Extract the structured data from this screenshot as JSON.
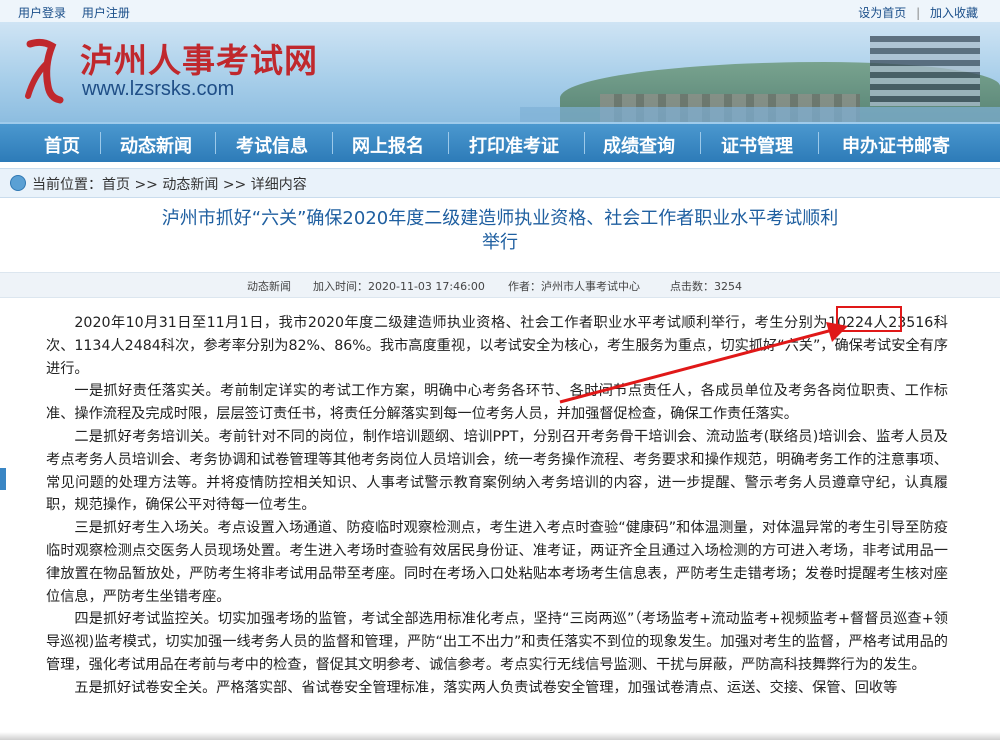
{
  "topbar": {
    "login": "用户登录",
    "register": "用户注册",
    "set_home": "设为首页",
    "separator": "|",
    "add_fav": "加入收藏"
  },
  "header": {
    "site_name": "泸州人事考试网",
    "site_url": "www.lzsrsks.com",
    "brand_color": "#c0282d"
  },
  "nav": {
    "items": [
      "首页",
      "动态新闻",
      "考试信息",
      "网上报名",
      "打印准考证",
      "成绩查询",
      "证书管理",
      "申办证书邮寄"
    ]
  },
  "breadcrumb": {
    "prefix": "当前位置：",
    "home": "首页",
    "sep": " >> ",
    "section": "动态新闻",
    "current": "详细内容"
  },
  "article": {
    "title_line1": "泸州市抓好“六关”确保2020年度二级建造师执业资格、社会工作者职业水平考试顺利",
    "title_line2": "举行",
    "meta": {
      "category": "动态新闻",
      "added": "加入时间：2020-11-03 17:46:00",
      "author": "作者：泸州市人事考试中心",
      "clicks": "点击数：3254"
    },
    "p1_before": "2020年10月31日至11月1日，我市2020年度二级建造师执业资格、社会工作者职业水平考试顺利举行，考生分别为",
    "p1_highlight": "10224人",
    "p1_after": "23516科次、1134人2484科次，参考率分别为82%、86%。我市高度重视，以考试安全为核心，考生服务为重点，切实抓好“六关”，确保考试安全有序进行。",
    "p2": "一是抓好责任落实关。考前制定详实的考试工作方案，明确中心考务各环节、各时间节点责任人，各成员单位及考务各岗位职责、工作标准、操作流程及完成时限，层层签订责任书，将责任分解落实到每一位考务人员，并加强督促检查，确保工作责任落实。",
    "p3": "二是抓好考务培训关。考前针对不同的岗位，制作培训题纲、培训PPT，分别召开考务骨干培训会、流动监考(联络员)培训会、监考人员及考点考务人员培训会、考务协调和试卷管理等其他考务岗位人员培训会，统一考务操作流程、考务要求和操作规范，明确考务工作的注意事项、常见问题的处理方法等。并将疫情防控相关知识、人事考试警示教育案例纳入考务培训的内容，进一步提醒、警示考务人员遵章守纪，认真履职，规范操作，确保公平对待每一位考生。",
    "p4": "三是抓好考生入场关。考点设置入场通道、防疫临时观察检测点，考生进入考点时查验“健康码”和体温测量，对体温异常的考生引导至防疫临时观察检测点交医务人员现场处置。考生进入考场时查验有效居民身份证、准考证，两证齐全且通过入场检测的方可进入考场，非考试用品一律放置在物品暂放处，严防考生将非考试用品带至考座。同时在考场入口处粘贴本考场考生信息表，严防考生走错考场；发卷时提醒考生核对座位信息，严防考生坐错考座。",
    "p5": "四是抓好考试监控关。切实加强考场的监管，考试全部选用标准化考点，坚持“三岗两巡”（考场监考+流动监考+视频监考+督督员巡查+领导巡视)监考模式，切实加强一线考务人员的监督和管理，严防“出工不出力”和责任落实不到位的现象发生。加强对考生的监督，严格考试用品的管理，强化考试用品在考前与考中的检查，督促其文明参考、诚信参考。考点实行无线信号监测、干扰与屏蔽，严防高科技舞弊行为的发生。",
    "p6": "五是抓好试卷安全关。严格落实部、省试卷安全管理标准，落实两人负责试卷安全管理，加强试卷清点、运送、交接、保管、回收等"
  },
  "annotation_color": "#e01818"
}
